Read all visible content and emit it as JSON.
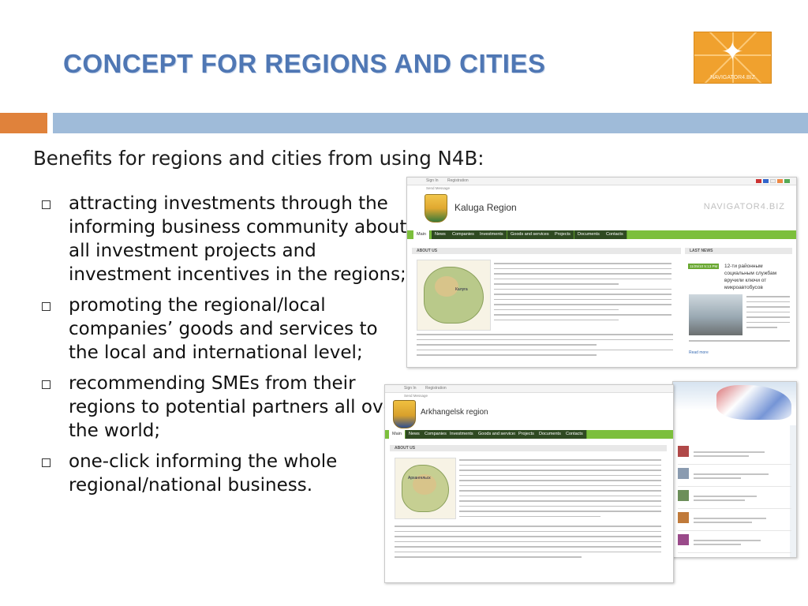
{
  "slide": {
    "title": "CONCEPT FOR REGIONS AND CITIES",
    "logo_text": "NAVIGATOR4.BIZ",
    "subtitle": "Benefits for regions and cities from using N4B:",
    "bullets": [
      "attracting investments through the informing business community about all investment projects and investment incentives in the regions;",
      "promoting the regional/local companies’ goods and services to the local and international level;",
      "recommending SMEs from their regions to potential partners all over the world;",
      "one-click informing the whole regional/national business."
    ]
  },
  "screenshot_kaluga": {
    "topbar": [
      "Sign In",
      "Registration",
      "Send Message"
    ],
    "region_title": "Kaluga Region",
    "brand": "NAVIGATOR4.BIZ",
    "nav": [
      "Main",
      "News",
      "Companies",
      "Investments",
      "Goods and services",
      "Projects",
      "Documents",
      "Contacts"
    ],
    "about_heading": "ABOUT US",
    "news_heading": "LAST NEWS",
    "map_label": "Калуга",
    "news_date": "11/25/10 5:13 PM",
    "news_title": "12-ти районным социальным службам вручили ключи от микроавтобусов",
    "read_more": "Read more"
  },
  "screenshot_arkhangelsk": {
    "topbar": [
      "Sign In",
      "Registration",
      "Send Message"
    ],
    "region_title": "Arkhangelsk region",
    "nav": [
      "Main",
      "News",
      "Companies",
      "Investments",
      "Goods and services",
      "Projects",
      "Documents",
      "Contacts"
    ],
    "about_heading": "ABOUT US",
    "map_label": "Архангельск"
  },
  "colors": {
    "title": "#4f77b4",
    "band_orange": "#e0823b",
    "band_blue": "#9fbbd9",
    "site_nav_green": "#7cbf3c",
    "logo_orange": "#f0a12e"
  },
  "icons": [
    "bullet-square-icon",
    "star-logo-icon",
    "region-crest-icon",
    "flag-icon"
  ]
}
